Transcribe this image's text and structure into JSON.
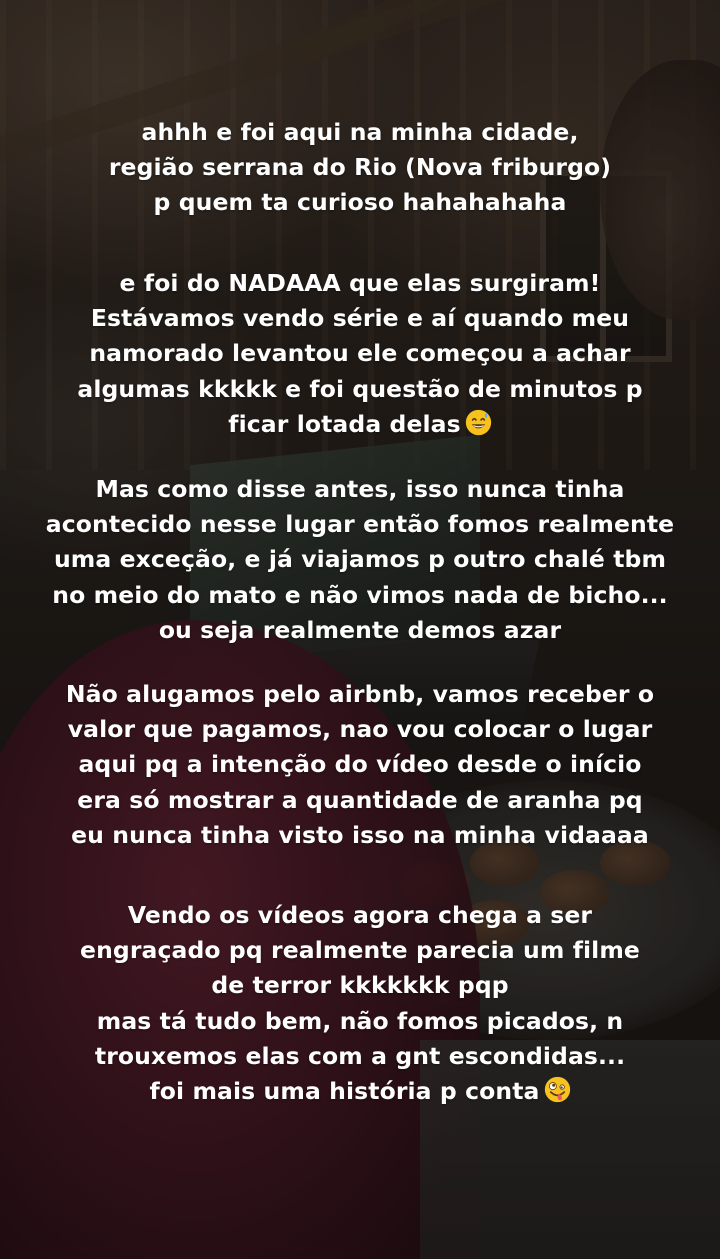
{
  "story": {
    "paragraphs": [
      {
        "lines": [
          "ahhh e foi aqui na minha  cidade,",
          "região serrana do Rio (Nova friburgo)",
          "p quem ta curioso hahahahaha"
        ]
      },
      {
        "lines": [
          "e foi do NADAAA que elas surgiram!",
          "Estávamos vendo série e aí quando meu",
          "namorado levantou ele começou a achar",
          "algumas kkkkk e foi questão de minutos p",
          "ficar lotada delas"
        ],
        "trailing_emoji": "grinning-face-with-sweat"
      },
      {
        "lines": [
          "Mas como disse antes, isso nunca tinha",
          "acontecido nesse lugar então fomos realmente",
          "uma exceção, e já viajamos p outro chalé tbm",
          "no meio do mato e não vimos nada de bicho...",
          "ou seja realmente demos azar"
        ]
      },
      {
        "lines": [
          "Não alugamos pelo airbnb, vamos receber o",
          "valor que pagamos, nao vou colocar o lugar",
          "aqui pq a intenção do vídeo desde o início",
          "era só mostrar a quantidade de aranha pq",
          "eu nunca tinha visto isso na minha vidaaaa"
        ]
      },
      {
        "lines": [
          "Vendo os vídeos agora chega a ser",
          "engraçado pq realmente parecia um filme",
          "de terror kkkkkkk pqp",
          "mas tá tudo bem, não fomos picados, n",
          "trouxemos elas com a gnt escondidas...",
          "foi mais uma história p conta"
        ],
        "trailing_emoji": "zany-face"
      }
    ]
  },
  "colors": {
    "text": "#ffffff",
    "emoji_yellow": "#f7c21d"
  }
}
